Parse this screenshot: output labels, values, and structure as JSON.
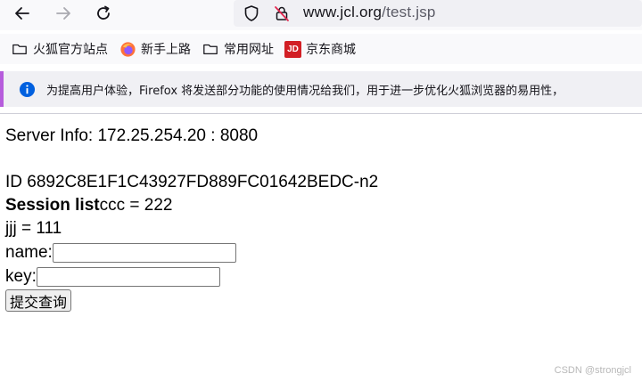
{
  "browser": {
    "url_domain": "www.jcl.org",
    "url_path": "/test.jsp",
    "bookmarks": [
      {
        "label": "火狐官方站点",
        "icon": "folder-icon"
      },
      {
        "label": "新手上路",
        "icon": "firefox-icon"
      },
      {
        "label": "常用网址",
        "icon": "folder-icon"
      },
      {
        "label": "京东商城",
        "icon": "jd-icon",
        "icon_text": "JD"
      }
    ],
    "notification": "为提高用户体验，Firefox 将发送部分功能的使用情况给我们，用于进一步优化火狐浏览器的易用性，"
  },
  "page": {
    "server_info": "Server Info: 172.25.254.20 : 8080",
    "id_line": "ID 6892C8E1F1C43927FD889FC01642BEDC-n2",
    "session_label": "Session list",
    "session_value": "ccc = 222",
    "jjj_line": "jjj = 111",
    "name_label": "name:",
    "name_value": "",
    "key_label": "key:",
    "key_value": "",
    "submit_label": "提交查询"
  },
  "watermark": "CSDN @strongjcl",
  "colors": {
    "notice_accent": "#b65cdc",
    "info_icon": "#0060df",
    "jd_red": "#d21f25"
  }
}
